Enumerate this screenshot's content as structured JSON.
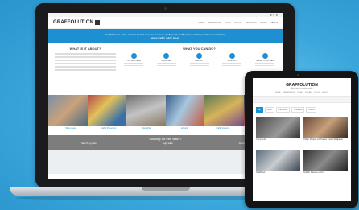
{
  "laptop_site": {
    "logo": "GRAFFOLUTION",
    "menu": [
      "HOME",
      "PREVENTION",
      "LOCAL",
      "SOCIAL",
      "RESEARCH",
      "TOOLS",
      "ABOUT"
    ],
    "hero_text": "Graffolution is a free and EU-funded resource for those dealing with graffiti, those working and those considering about graffiti, public street.",
    "what_is_it_title": "WHAT IS IT ABOUT?",
    "what_you_can_do_title": "WHAT YOU CAN DO?",
    "features": [
      {
        "label": "YOU ARE HERE",
        "icon": "pin-icon"
      },
      {
        "label": "DISCOVER",
        "icon": "compass-icon"
      },
      {
        "label": "REPORT",
        "icon": "report-icon"
      },
      {
        "label": "CONNECT",
        "icon": "chat-icon"
      },
      {
        "label": "SHARE YOUR IDEA",
        "icon": "share-icon"
      }
    ],
    "captions": [
      "Share ideas",
      "Graffiti Prevention",
      "Spotlights",
      "Artwork",
      "Graffiti projects",
      "Results"
    ],
    "looking_for": "Looking for free walls?",
    "find_options": [
      "Search by place",
      "Legal walls",
      "Community"
    ],
    "map_zoom": "+ −"
  },
  "tablet_site": {
    "logo": "GRAFFOLUTION",
    "tagline": "Awareness for urban graffiti",
    "menu": [
      "HOME",
      "PREVENTION",
      "LOCAL",
      "SOCIAL",
      "TOOLS",
      "ABOUT"
    ],
    "tabs": [
      "All",
      "Ideas",
      "Prevention",
      "Spotlights",
      "Graffiti"
    ],
    "cards": [
      {
        "caption": "Community"
      },
      {
        "caption": "Urban Project: Art Project inside Wallpaper"
      },
      {
        "caption": "Graffiti art"
      },
      {
        "caption": "Graffiti: Results of Art"
      }
    ]
  },
  "colors": {
    "accent": "#1e8fd0",
    "background": "#2f9fd6",
    "device": "#1b1b1d"
  }
}
